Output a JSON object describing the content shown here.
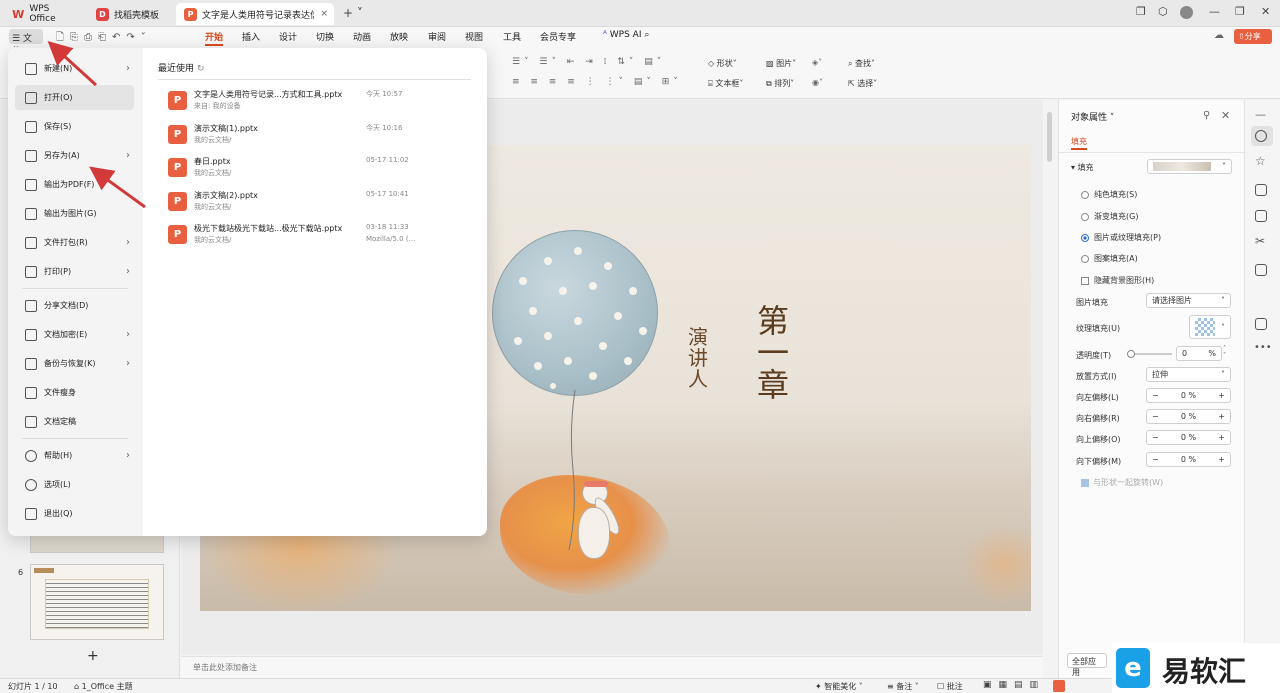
{
  "tabs": [
    {
      "label": "WPS Office"
    },
    {
      "label": "找稻壳模板"
    },
    {
      "label": "文字是人类用符号记录表达信息以"
    }
  ],
  "menu": {
    "file_label": "文件",
    "items": [
      "开始",
      "插入",
      "设计",
      "切换",
      "动画",
      "放映",
      "审阅",
      "视图",
      "工具",
      "会员专享"
    ],
    "wps_ai": "WPS AI",
    "share": "分享"
  },
  "ribbon": {
    "shape": "形状",
    "picture": "图片",
    "textbox": "文本框",
    "arrange": "排列",
    "find": "查找",
    "select": "选择"
  },
  "file_menu": {
    "items": [
      {
        "label": "新建(N)",
        "arrow": true
      },
      {
        "label": "打开(O)",
        "arrow": false
      },
      {
        "label": "保存(S)",
        "arrow": false
      },
      {
        "label": "另存为(A)",
        "arrow": true
      },
      {
        "label": "输出为PDF(F)",
        "arrow": false
      },
      {
        "label": "输出为图片(G)",
        "arrow": false
      },
      {
        "label": "文件打包(R)",
        "arrow": true
      },
      {
        "label": "打印(P)",
        "arrow": true
      },
      {
        "label": "分享文档(D)",
        "arrow": false
      },
      {
        "label": "文档加密(E)",
        "arrow": true
      },
      {
        "label": "备份与恢复(K)",
        "arrow": true
      },
      {
        "label": "文件瘦身",
        "arrow": false
      },
      {
        "label": "文档定稿",
        "arrow": false
      },
      {
        "label": "帮助(H)",
        "arrow": true
      },
      {
        "label": "选项(L)",
        "arrow": false
      },
      {
        "label": "退出(Q)",
        "arrow": false
      }
    ],
    "recent_title": "最近使用",
    "recent": [
      {
        "name": "文字是人类用符号记录...方式和工具.pptx",
        "sub": "来自: 我的设备",
        "time": "今天 10:57",
        "extra": ""
      },
      {
        "name": "演示文稿(1).pptx",
        "sub": "我的云文档/",
        "time": "今天 10:16",
        "extra": ""
      },
      {
        "name": "春日.pptx",
        "sub": "我的云文档/",
        "time": "05-17 11:02",
        "extra": ""
      },
      {
        "name": "演示文稿(2).pptx",
        "sub": "我的云文档/",
        "time": "05-17 10:41",
        "extra": ""
      },
      {
        "name": "极光下载站极光下载站...极光下载站.pptx",
        "sub": "我的云文档/",
        "time": "03-18 11:33",
        "extra": "Mozilla/5.0 (..."
      }
    ]
  },
  "slide": {
    "title": "第一章",
    "speaker": "演讲人"
  },
  "thumbnails": {
    "slide_number": "6",
    "add": "+"
  },
  "notes_placeholder": "单击此处添加备注",
  "panel": {
    "title": "对象属性",
    "tab": "填充",
    "section": "填充",
    "options": [
      "纯色填充(S)",
      "渐变填充(G)",
      "图片或纹理填充(P)",
      "图案填充(A)"
    ],
    "hide_bg": "隐藏背景图形(H)",
    "pic_fill_label": "图片填充",
    "pic_fill_value": "请选择图片",
    "texture_label": "纹理填充(U)",
    "transparency_label": "透明度(T)",
    "transparency_value": "0",
    "transparency_unit": "%",
    "placement_label": "放置方式(I)",
    "placement_value": "拉伸",
    "offsets": [
      {
        "label": "向左偏移(L)",
        "value": "0",
        "unit": "%"
      },
      {
        "label": "向右偏移(R)",
        "value": "0",
        "unit": "%"
      },
      {
        "label": "向上偏移(O)",
        "value": "0",
        "unit": "%"
      },
      {
        "label": "向下偏移(M)",
        "value": "0",
        "unit": "%"
      }
    ],
    "rotate_with_shape": "与形状一起旋转(W)",
    "apply_all": "全部应用"
  },
  "status": {
    "slide_info": "幻灯片 1 / 10",
    "theme": "1_Office 主题",
    "smart": "智能美化",
    "notes": "备注",
    "comment": "批注"
  },
  "watermark": "易软汇",
  "colors": {
    "accent": "#d94a1e",
    "wps_red": "#e8603f",
    "selected_blue": "#2d6fd8",
    "arrow_red": "#d23a3a"
  }
}
